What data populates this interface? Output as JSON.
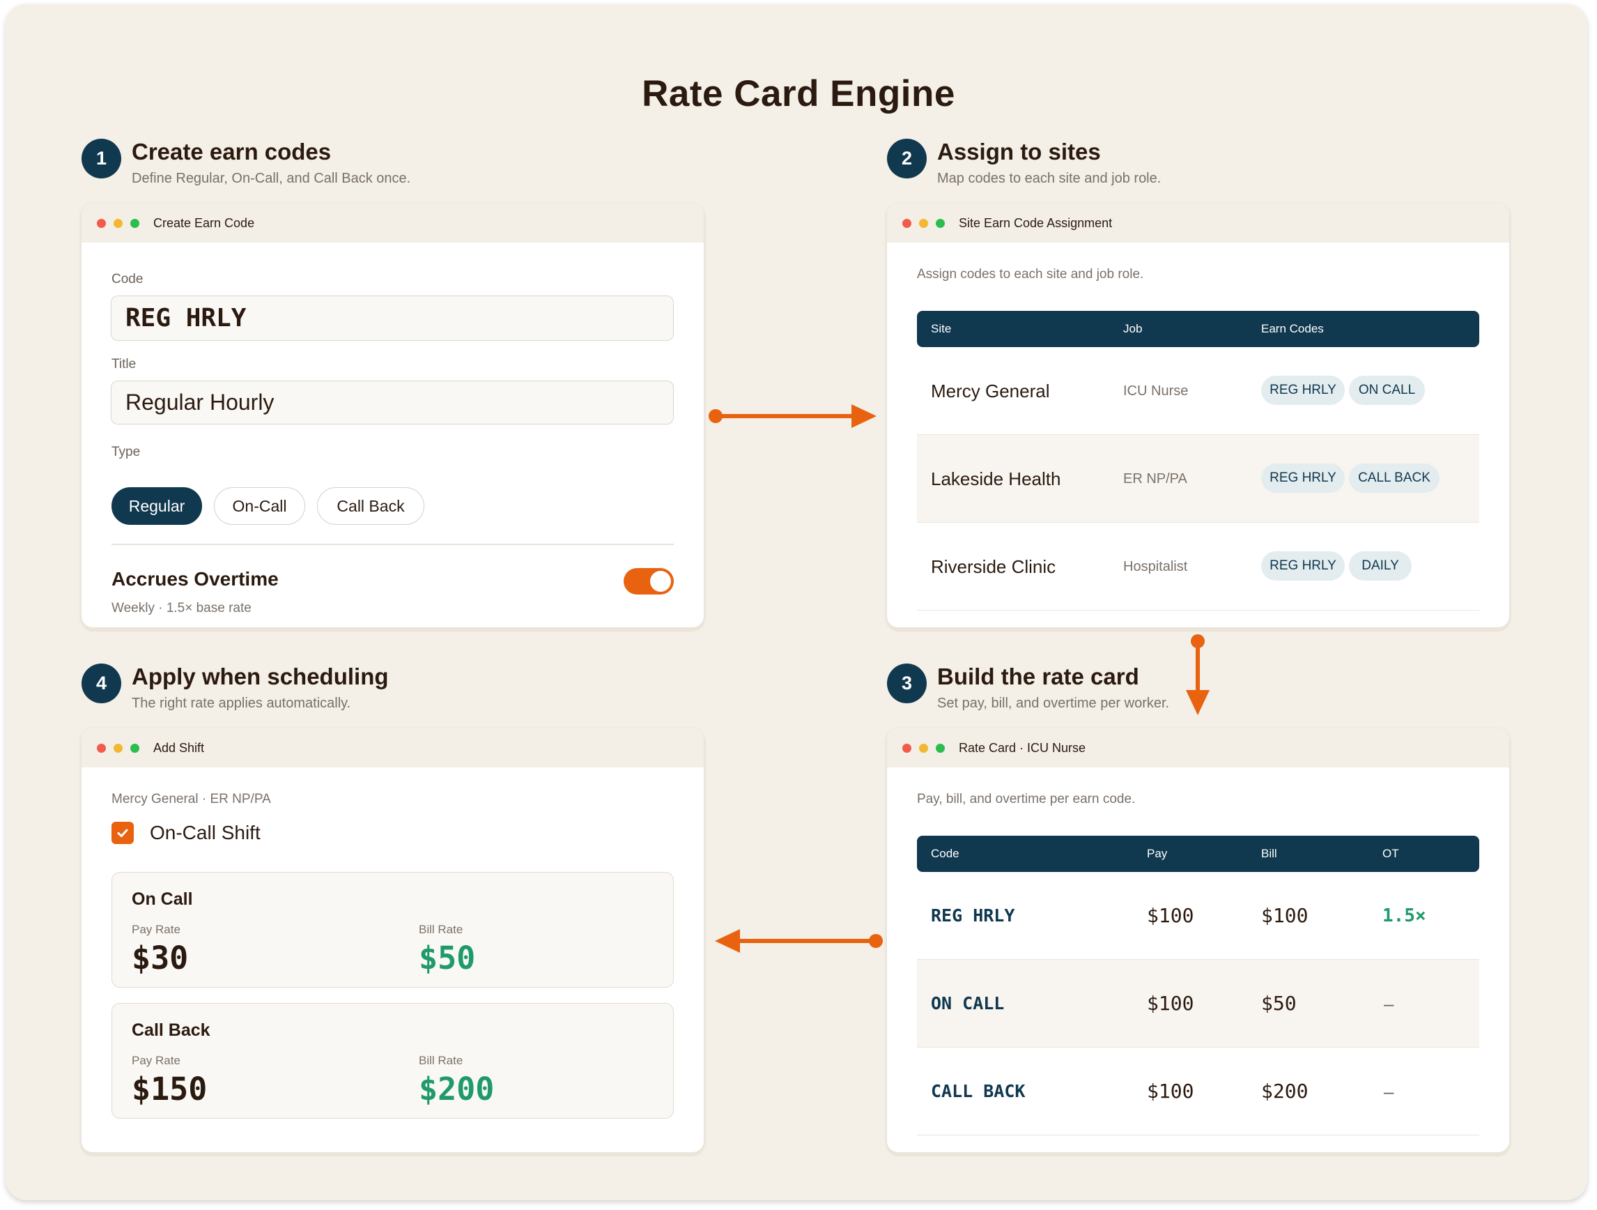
{
  "title": "Rate Card Engine",
  "steps": [
    {
      "num": "1",
      "title": "Create earn codes",
      "subtitle": "Define Regular, On-Call, and Call Back once."
    },
    {
      "num": "2",
      "title": "Assign to sites",
      "subtitle": "Map codes to each site and job role."
    },
    {
      "num": "3",
      "title": "Build the rate card",
      "subtitle": "Set pay, bill, and overtime per worker."
    },
    {
      "num": "4",
      "title": "Apply when scheduling",
      "subtitle": "The right rate applies automatically."
    }
  ],
  "create_card": {
    "window_title": "Create Earn Code",
    "code_label": "Code",
    "code_value": "REG HRLY",
    "title_label": "Title",
    "title_value": "Regular Hourly",
    "type_label": "Type",
    "types": [
      "Regular",
      "On-Call",
      "Call Back"
    ],
    "selected_type": "Regular",
    "overtime_label": "Accrues Overtime",
    "overtime_sub": "Weekly · 1.5× base rate",
    "overtime_on": true
  },
  "assign_card": {
    "window_title": "Site Earn Code Assignment",
    "intro": "Assign codes to each site and job role.",
    "headers": [
      "Site",
      "Job",
      "Earn Codes"
    ],
    "rows": [
      {
        "site": "Mercy General",
        "job": "ICU Nurse",
        "codes": [
          "REG HRLY",
          "ON CALL"
        ]
      },
      {
        "site": "Lakeside Health",
        "job": "ER NP/PA",
        "codes": [
          "REG HRLY",
          "CALL BACK"
        ]
      },
      {
        "site": "Riverside Clinic",
        "job": "Hospitalist",
        "codes": [
          "REG HRLY",
          "DAILY"
        ]
      }
    ]
  },
  "rate_card": {
    "window_title": "Rate Card · ICU Nurse",
    "intro": "Pay, bill, and overtime per earn code.",
    "headers": [
      "Code",
      "Pay",
      "Bill",
      "OT"
    ],
    "rows": [
      {
        "code": "REG HRLY",
        "pay": "$100",
        "bill": "$100",
        "ot": "1.5×"
      },
      {
        "code": "ON CALL",
        "pay": "$100",
        "bill": "$50",
        "ot": "–"
      },
      {
        "code": "CALL BACK",
        "pay": "$100",
        "bill": "$200",
        "ot": "–"
      }
    ]
  },
  "shift_card": {
    "window_title": "Add Shift",
    "context": "Mercy General · ER NP/PA",
    "checkbox_label": "On-Call Shift",
    "checked": true,
    "boxes": [
      {
        "title": "On Call",
        "pay_label": "Pay Rate",
        "pay": "$30",
        "bill_label": "Bill Rate",
        "bill": "$50"
      },
      {
        "title": "Call Back",
        "pay_label": "Pay Rate",
        "pay": "$150",
        "bill_label": "Bill Rate",
        "bill": "$200"
      }
    ]
  },
  "colors": {
    "navy": "#10384f",
    "accent_orange": "#e8620f",
    "bill_green": "#1f9a6a",
    "background": "#f4efe7"
  }
}
